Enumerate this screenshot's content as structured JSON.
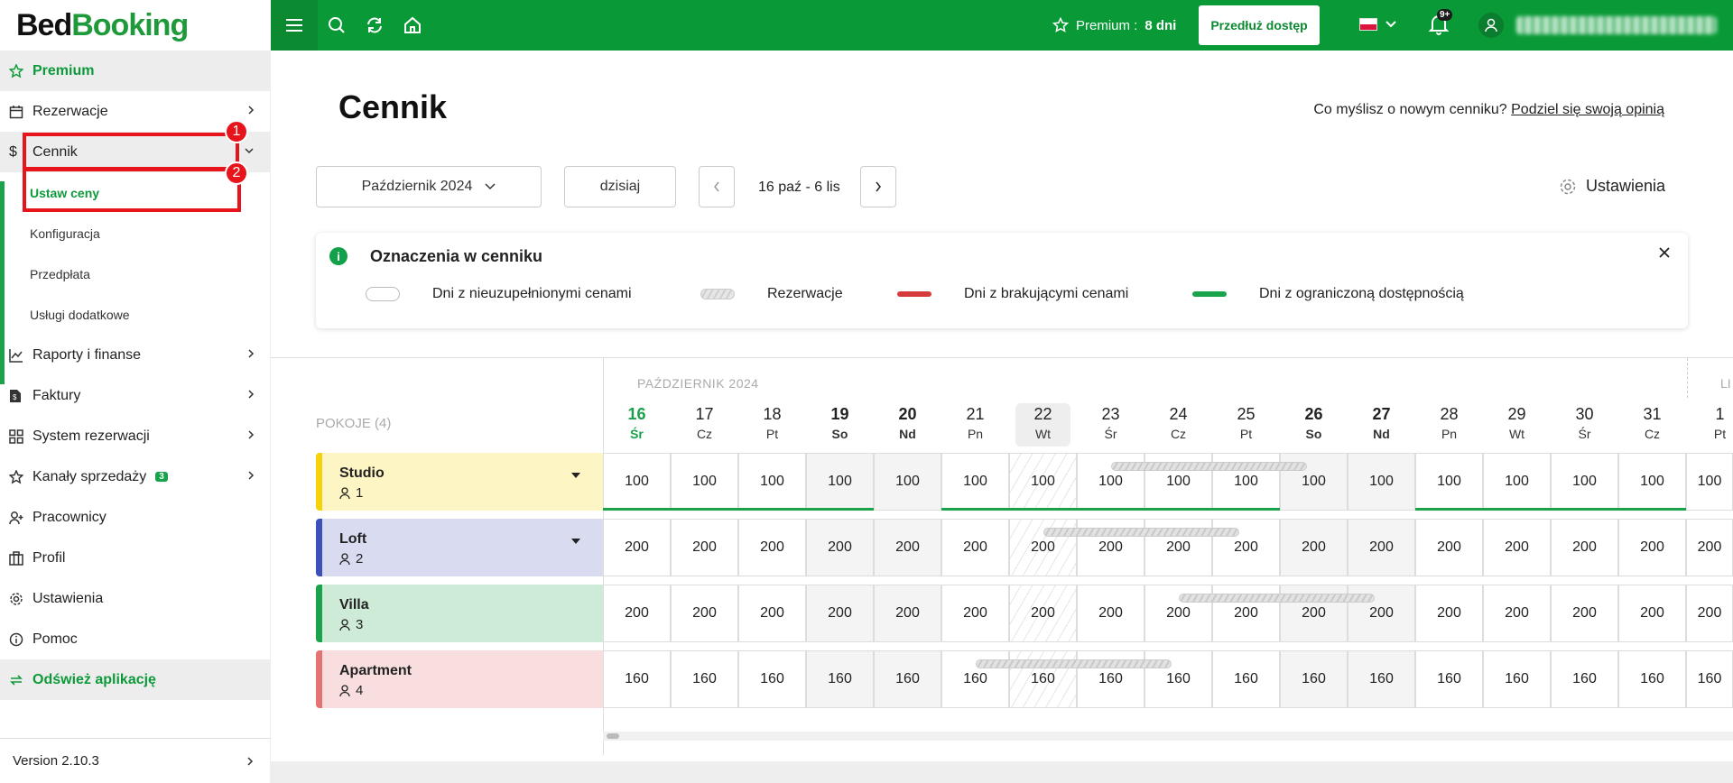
{
  "app": {
    "logo_part1": "Bed",
    "logo_part2": "Booking"
  },
  "topbar": {
    "premium_label": "Premium :",
    "premium_days": "8 dni",
    "extend_button": "Przedłuż dostęp",
    "notifications_badge": "9+",
    "colors": {
      "bar": "#099a37"
    }
  },
  "sidebar": {
    "premium": "Premium",
    "items": [
      {
        "label": "Rezerwacje",
        "icon": "calendar-icon"
      },
      {
        "label": "Cennik",
        "icon": "dollar-icon"
      }
    ],
    "sub_items": [
      "Ustaw ceny",
      "Konfiguracja",
      "Przedpłata",
      "Usługi dodatkowe"
    ],
    "items2": [
      {
        "label": "Raporty i finanse",
        "icon": "chart-icon"
      },
      {
        "label": "Faktury",
        "icon": "invoice-icon"
      },
      {
        "label": "System rezerwacji",
        "icon": "grid-icon"
      },
      {
        "label": "Kanały sprzedaży",
        "icon": "star-icon",
        "badge": "3"
      },
      {
        "label": "Pracownicy",
        "icon": "user-plus-icon"
      },
      {
        "label": "Profil",
        "icon": "building-icon"
      },
      {
        "label": "Ustawienia",
        "icon": "gear-icon"
      },
      {
        "label": "Pomoc",
        "icon": "info-icon"
      }
    ],
    "refresh": "Odśwież aplikację",
    "version": "Version 2.10.3"
  },
  "annotations": [
    "1",
    "2"
  ],
  "page": {
    "title": "Cennik",
    "opinion_text": "Co myślisz o nowym cenniku?",
    "opinion_link": "Podziel się swoją opinią",
    "month_select": "Październik 2024",
    "today_button": "dzisiaj",
    "range": "16 paź - 6 lis",
    "settings": "Ustawienia"
  },
  "legend": {
    "title": "Oznaczenia w cenniku",
    "info": "i",
    "items": [
      "Dni z nieuzupełnionymi cenami",
      "Rezerwacje",
      "Dni z brakującymi cenami",
      "Dni z ograniczoną dostępnością"
    ],
    "colors": {
      "missing": "#d63b3b",
      "limited": "#1aa34a"
    }
  },
  "calendar": {
    "rooms_label": "POKOJE (4)",
    "month_label": "PAŹDZIERNIK 2024",
    "next_month_label": "LI",
    "days": [
      {
        "n": "16",
        "w": "Śr"
      },
      {
        "n": "17",
        "w": "Cz"
      },
      {
        "n": "18",
        "w": "Pt"
      },
      {
        "n": "19",
        "w": "So"
      },
      {
        "n": "20",
        "w": "Nd"
      },
      {
        "n": "21",
        "w": "Pn"
      },
      {
        "n": "22",
        "w": "Wt"
      },
      {
        "n": "23",
        "w": "Śr"
      },
      {
        "n": "24",
        "w": "Cz"
      },
      {
        "n": "25",
        "w": "Pt"
      },
      {
        "n": "26",
        "w": "So"
      },
      {
        "n": "27",
        "w": "Nd"
      },
      {
        "n": "28",
        "w": "Pn"
      },
      {
        "n": "29",
        "w": "Wt"
      },
      {
        "n": "30",
        "w": "Śr"
      },
      {
        "n": "31",
        "w": "Cz"
      },
      {
        "n": "1",
        "w": "Pt"
      }
    ],
    "rooms": [
      {
        "name": "Studio",
        "count": "1",
        "price": "100",
        "color": "#fdf6c4",
        "stripe": "#f5d20a"
      },
      {
        "name": "Loft",
        "count": "2",
        "price": "200",
        "color": "#d9dcf0",
        "stripe": "#3d4fb8"
      },
      {
        "name": "Villa",
        "count": "3",
        "price": "200",
        "color": "#cdebd7",
        "stripe": "#1aa34a"
      },
      {
        "name": "Apartment",
        "count": "4",
        "price": "160",
        "color": "#f8dede",
        "stripe": "#e57373"
      }
    ]
  }
}
